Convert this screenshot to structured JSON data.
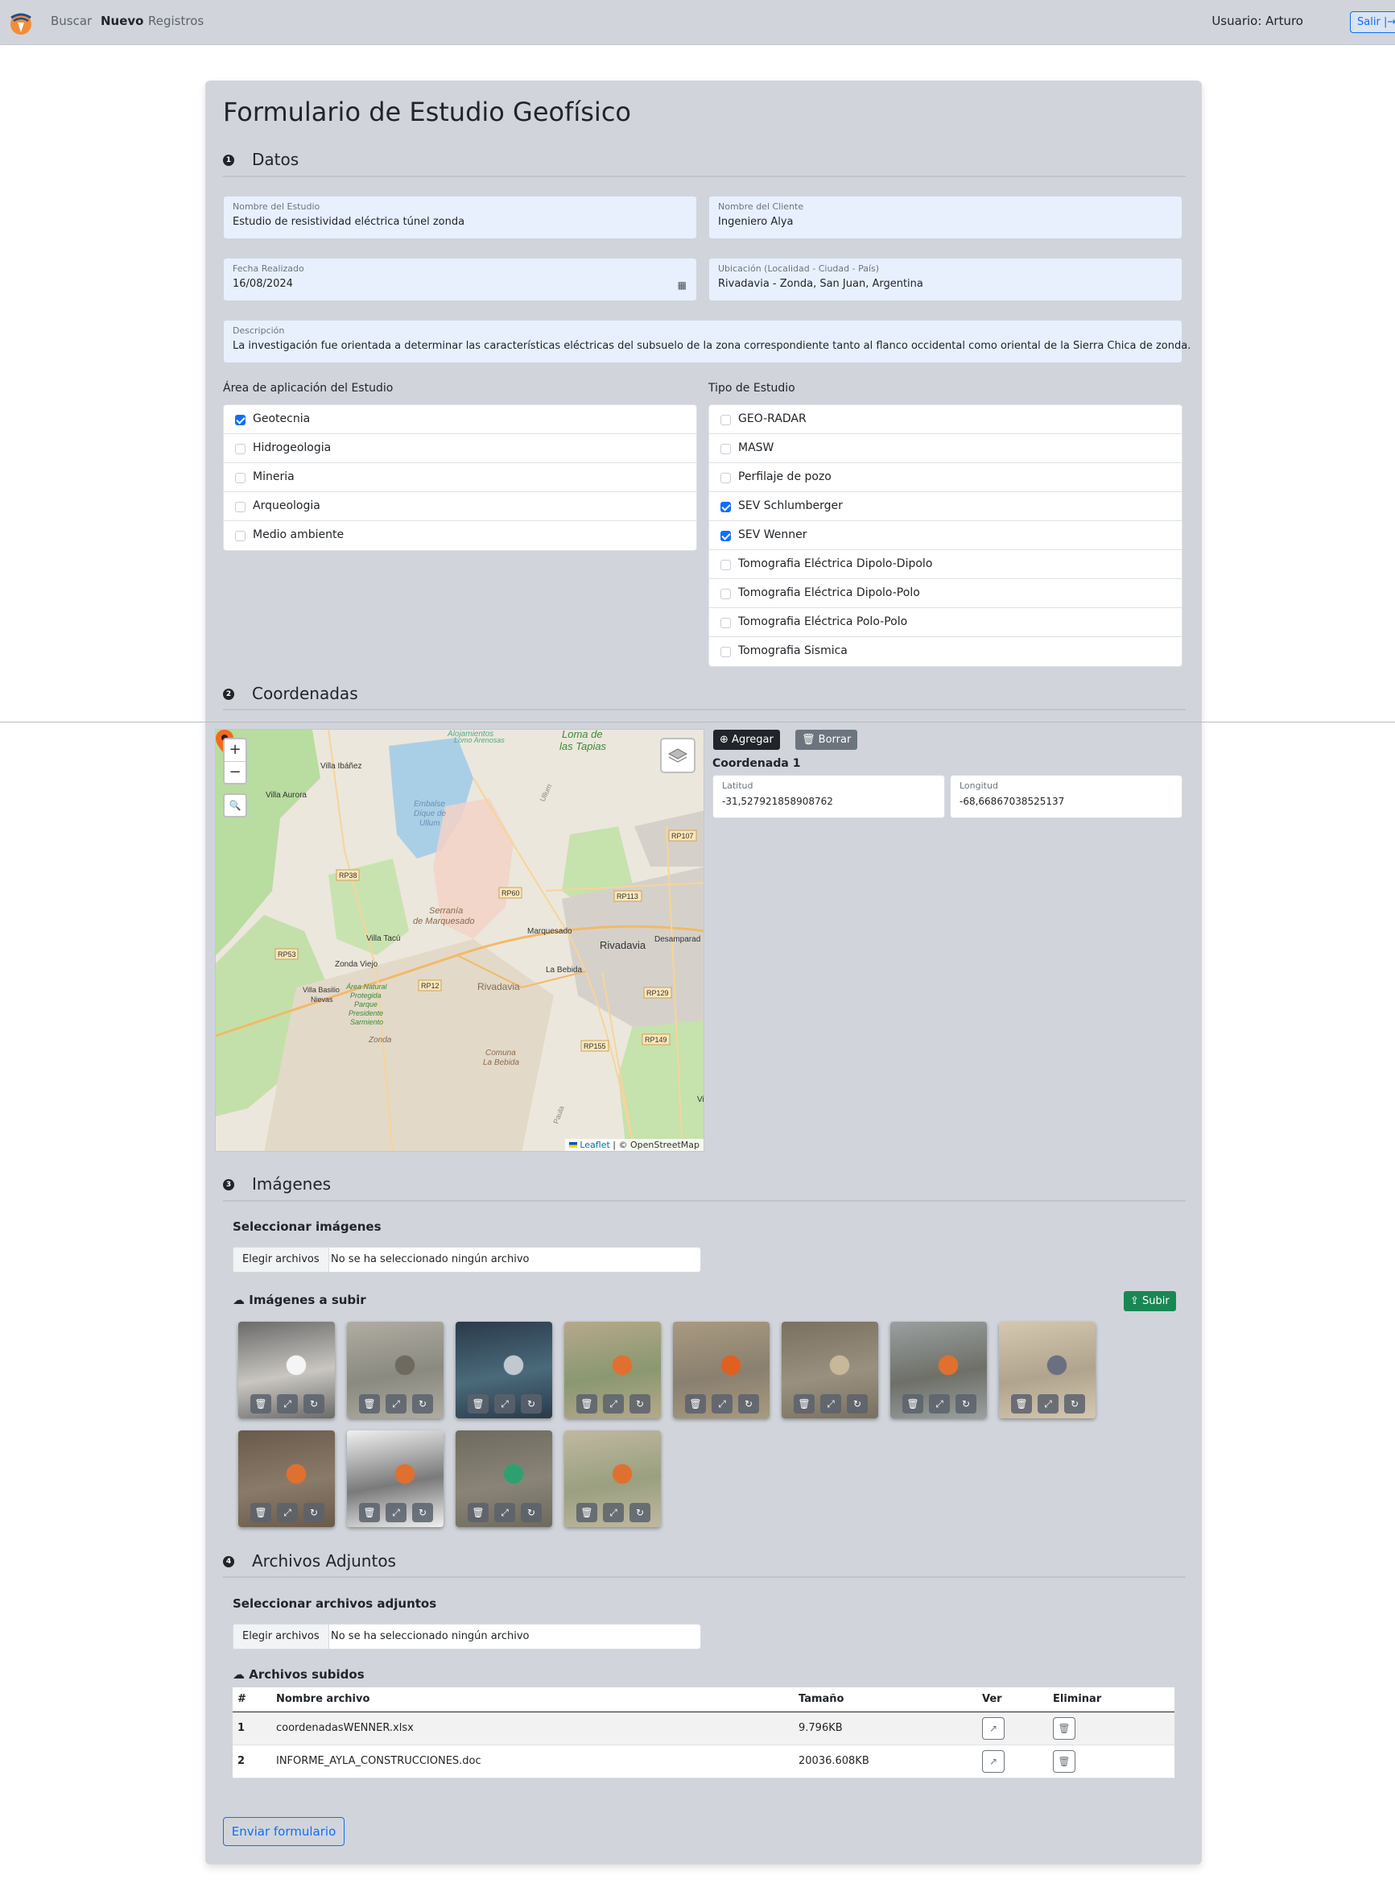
{
  "navbar": {
    "links": [
      "Buscar",
      "Nuevo",
      "Registros"
    ],
    "user": "Usuario: Arturo",
    "logout": "Salir",
    "logout_icon": "box-arrow-right-icon"
  },
  "form": {
    "title": "Formulario de Estudio Geofísico",
    "sections": [
      {
        "num": "1",
        "title": "Datos"
      },
      {
        "num": "2",
        "title": "Coordenadas"
      },
      {
        "num": "3",
        "title": "Imágenes"
      },
      {
        "num": "4",
        "title": "Archivos Adjuntos"
      }
    ],
    "fields": {
      "study_name": {
        "label": "Nombre del Estudio",
        "value": "Estudio de resistividad eléctrica túnel zonda"
      },
      "client_name": {
        "label": "Nombre del Cliente",
        "value": "Ingeniero Alya"
      },
      "date": {
        "label": "Fecha Realizado",
        "value": "16/08/2024"
      },
      "location": {
        "label": "Ubicación (Localidad - Ciudad - País)",
        "value": "Rivadavia - Zonda, San Juan, Argentina"
      },
      "description": {
        "label": "Descripción",
        "value": "La investigación fue orientada a determinar las características eléctricas del subsuelo de la zona correspondiente tanto al flanco occidental como oriental de la Sierra Chica de zonda."
      }
    },
    "area": {
      "label": "Área de aplicación del Estudio",
      "items": [
        {
          "label": "Geotecnia",
          "checked": "true"
        },
        {
          "label": "Hidrogeologia",
          "checked": "false"
        },
        {
          "label": "Mineria",
          "checked": "false"
        },
        {
          "label": "Arqueologia",
          "checked": "false"
        },
        {
          "label": "Medio ambiente",
          "checked": "false"
        }
      ]
    },
    "study_type": {
      "label": "Tipo de Estudio",
      "items": [
        {
          "label": "GEO-RADAR",
          "checked": "false"
        },
        {
          "label": "MASW",
          "checked": "false"
        },
        {
          "label": "Perfilaje de pozo",
          "checked": "false"
        },
        {
          "label": "SEV Schlumberger",
          "checked": "true"
        },
        {
          "label": "SEV Wenner",
          "checked": "true"
        },
        {
          "label": "Tomografia Eléctrica Dipolo-Dipolo",
          "checked": "false"
        },
        {
          "label": "Tomografia Eléctrica Dipolo-Polo",
          "checked": "false"
        },
        {
          "label": "Tomografia Eléctrica Polo-Polo",
          "checked": "false"
        },
        {
          "label": "Tomografia Sismica",
          "checked": "false"
        }
      ]
    }
  },
  "map": {
    "zoom_in": "+",
    "zoom_out": "−",
    "search": "🔍",
    "attribution_leaflet": "Leaflet",
    "attribution_osm": "| © OpenStreetMap",
    "labels": [
      "Loma de",
      "las Tapias",
      "Villa Ibáñez",
      "Villa Aurora",
      "Embalse",
      "Dique de",
      "Ullum",
      "RP107",
      "RP38",
      "RP60",
      "RP113",
      "Serranía",
      "de Marquesado",
      "Marquesado",
      "Villa Tacú",
      "Rivadavia",
      "Desamparad",
      "RP53",
      "Zonda Viejo",
      "La Bebida",
      "RP12",
      "Villa Basilio",
      "Nievas",
      "Área Natural",
      "Protegida",
      "Parque",
      "Presidente",
      "Sarmiento",
      "RP129",
      "Zonda",
      "RP155",
      "RP149",
      "Comuna",
      "La Bebida",
      "Rivadavia",
      "Ullum",
      "Alojamientos",
      "Lomo Arenosas",
      "Paula"
    ]
  },
  "coords": {
    "add": "Agregar",
    "delete": "Borrar",
    "heading": "Coordenada 1",
    "lat_label": "Latitud",
    "lat_value": "-31,527921858908762",
    "lon_label": "Longitud",
    "lon_value": "-68,66867038525137"
  },
  "images": {
    "select_label": "Seleccionar imágenes",
    "choose_btn": "Elegir archivos",
    "no_file": "No se ha seleccionado ningún archivo",
    "to_upload": "Imágenes a subir",
    "upload_btn": "Subir",
    "count": 12
  },
  "attachments": {
    "select_label": "Seleccionar archivos adjuntos",
    "choose_btn": "Elegir archivos",
    "no_file": "No se ha seleccionado ningún archivo",
    "uploaded": "Archivos subidos",
    "columns": [
      "#",
      "Nombre archivo",
      "Tamaño",
      "Ver",
      "Eliminar"
    ],
    "rows": [
      {
        "num": "1",
        "name": "coordenadasWENNER.xlsx",
        "size": "9.796KB"
      },
      {
        "num": "2",
        "name": "INFORME_AYLA_CONSTRUCCIONES.doc",
        "size": "20036.608KB"
      }
    ]
  },
  "submit": "Enviar formulario",
  "colors": {
    "primary": "#0d6efd",
    "success": "#198754",
    "card": "#d1d5db",
    "field": "#e8f0fe"
  }
}
